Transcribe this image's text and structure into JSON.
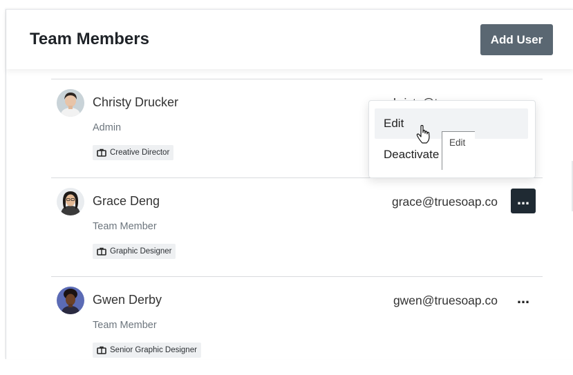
{
  "header": {
    "title": "Team Members",
    "add_user_label": "Add User"
  },
  "members": [
    {
      "name": "Christy Drucker",
      "role": "Admin",
      "tag": "Creative Director",
      "email": "christy@truesoap.co",
      "menu_open": true
    },
    {
      "name": "Grace Deng",
      "role": "Team Member",
      "tag": "Graphic Designer",
      "email": "grace@truesoap.co",
      "menu_open": false
    },
    {
      "name": "Gwen Derby",
      "role": "Team Member",
      "tag": "Senior Graphic Designer",
      "email": "gwen@truesoap.co",
      "menu_open": false
    }
  ],
  "dropdown": {
    "items": [
      "Edit",
      "Deactivate"
    ],
    "hovered": "Edit",
    "tooltip": "Edit"
  },
  "more_icon": "…",
  "colors": {
    "primary_button": "#5a6772",
    "active_more_button": "#1f2a33",
    "tag_bg": "#eef0f2",
    "divider": "#d8dadd"
  },
  "icons": {
    "tag": "briefcase-icon",
    "more": "ellipsis-icon",
    "cursor": "hand-pointer-icon"
  }
}
